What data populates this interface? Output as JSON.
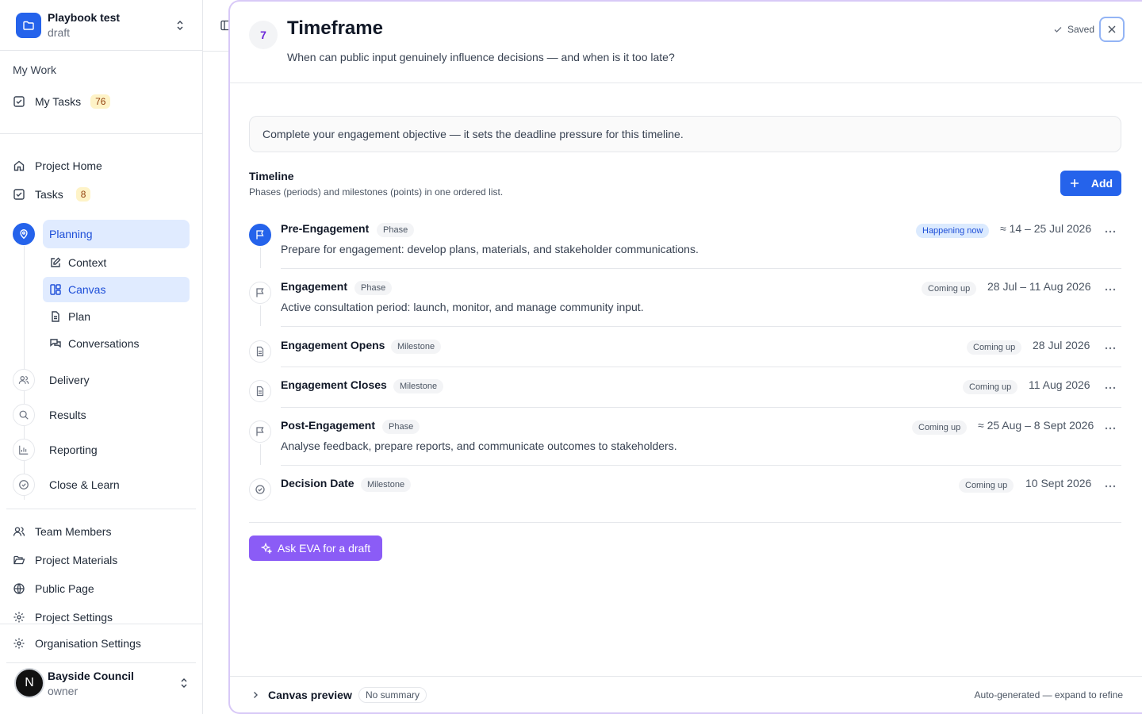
{
  "project": {
    "name": "Playbook test",
    "status": "draft"
  },
  "sidebar": {
    "my_work_label": "My Work",
    "my_tasks": {
      "label": "My Tasks",
      "count": "76"
    },
    "project_home": "Project Home",
    "tasks": {
      "label": "Tasks",
      "count": "8"
    },
    "stages": {
      "planning": "Planning",
      "delivery": "Delivery",
      "results": "Results",
      "reporting": "Reporting",
      "close": "Close & Learn"
    },
    "planning_items": [
      "Context",
      "Canvas",
      "Plan",
      "Conversations"
    ],
    "bottom_items": [
      "Team Members",
      "Project Materials",
      "Public Page",
      "Project Settings",
      "Organisation Settings"
    ],
    "user": {
      "initial": "N",
      "name": "Bayside Council",
      "role": "owner"
    }
  },
  "panel": {
    "step": "7",
    "title": "Timeframe",
    "subtitle": "When can public input genuinely influence decisions — and when is it too late?",
    "saved": "Saved",
    "notice": "Complete your engagement objective — it sets the deadline pressure for this timeline.",
    "timeline_title": "Timeline",
    "timeline_sub": "Phases (periods) and milestones (points) in one ordered list.",
    "add_label": "Add",
    "rows": [
      {
        "name": "Pre-Engagement",
        "type": "Phase",
        "desc": "Prepare for engagement: develop plans, materials, and stakeholder communications.",
        "status": "Happening now",
        "dates": "≈ 14 – 25 Jul 2026"
      },
      {
        "name": "Engagement",
        "type": "Phase",
        "desc": "Active consultation period: launch, monitor, and manage community input.",
        "status": "Coming up",
        "dates": "28 Jul – 11 Aug 2026"
      },
      {
        "name": "Engagement Opens",
        "type": "Milestone",
        "desc": "",
        "status": "Coming up",
        "dates": "28 Jul 2026"
      },
      {
        "name": "Engagement Closes",
        "type": "Milestone",
        "desc": "",
        "status": "Coming up",
        "dates": "11 Aug 2026"
      },
      {
        "name": "Post-Engagement",
        "type": "Phase",
        "desc": "Analyse feedback, prepare reports, and communicate outcomes to stakeholders.",
        "status": "Coming up",
        "dates": "≈ 25 Aug – 8 Sept 2026"
      },
      {
        "name": "Decision Date",
        "type": "Milestone",
        "desc": "",
        "status": "Coming up",
        "dates": "10 Sept 2026"
      }
    ],
    "eva_label": "Ask EVA for a draft",
    "footer": {
      "title": "Canvas preview",
      "badge": "No summary",
      "note": "Auto-generated — expand to refine"
    }
  },
  "colors": {
    "accent": "#2563eb",
    "eva": "#8b5cf6",
    "panel_border": "#d8c9f7"
  }
}
